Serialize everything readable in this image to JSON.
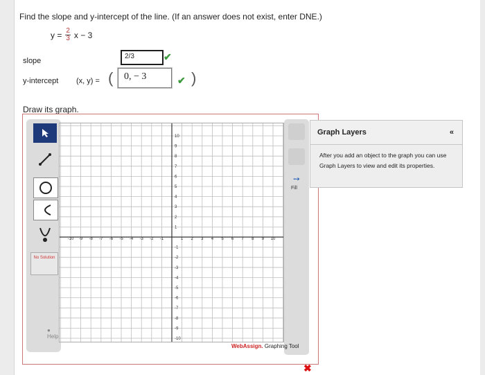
{
  "question": {
    "text": "Find the slope and y-intercept of the line. (If an answer does not exist, enter DNE.)"
  },
  "equation": {
    "lhs": "y =",
    "num": "2",
    "den": "3",
    "rhs": "x − 3"
  },
  "slope": {
    "label": "slope",
    "value": "2/3"
  },
  "yintercept": {
    "label": "y-intercept",
    "coord": "(x, y) =",
    "value": "0, − 3"
  },
  "graph": {
    "prompt": "Draw its graph.",
    "xticks": [
      "-10",
      "-9",
      "-8",
      "-7",
      "-6",
      "-5",
      "-4",
      "-3",
      "-2",
      "-1",
      "1",
      "2",
      "3",
      "4",
      "5",
      "6",
      "7",
      "8",
      "9",
      "10"
    ],
    "yticks": [
      "10",
      "9",
      "8",
      "7",
      "6",
      "5",
      "4",
      "3",
      "2",
      "1",
      "-1",
      "-2",
      "-3",
      "-4",
      "-5",
      "-6",
      "-7",
      "-8",
      "-9",
      "-10"
    ],
    "no_solution": "No Solution",
    "help": "Help",
    "fill": "Fill",
    "brand_a": "WebAssign.",
    "brand_b": " Graphing Tool"
  },
  "layers": {
    "title": "Graph Layers",
    "collapse": "«",
    "body": "After you add an object to the graph you can use Graph Layers to view and edit its properties."
  },
  "colors": {
    "correct": "#3e9a3e",
    "incorrect": "#d11111",
    "tool_active": "#1f3a7a"
  }
}
